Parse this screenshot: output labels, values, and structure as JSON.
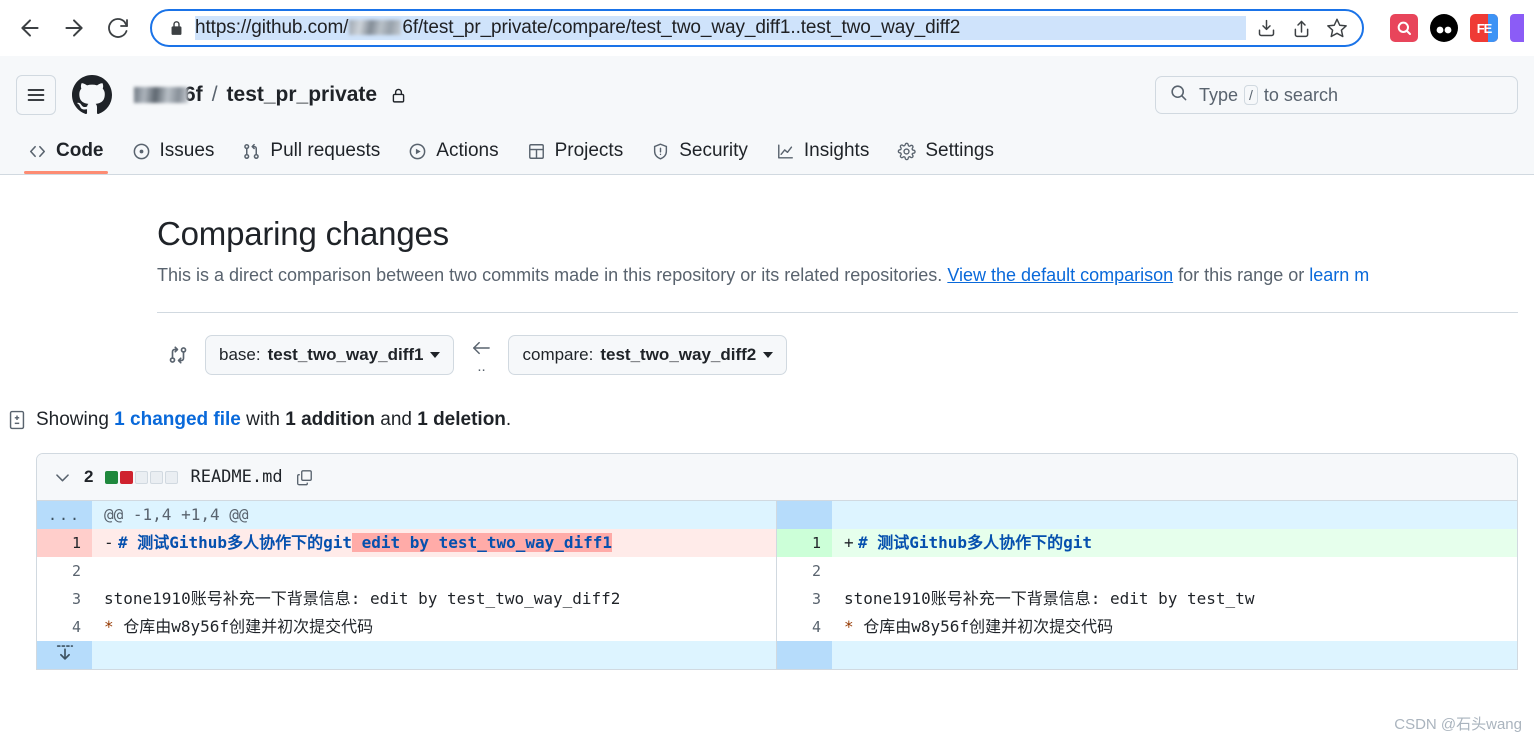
{
  "browser": {
    "back_label": "Back",
    "forward_label": "Forward",
    "reload_label": "Reload",
    "url_prefix": "https://github.com/",
    "url_suffix": "6f/test_pr_private/compare/test_two_way_diff1..test_two_way_diff2",
    "lock_icon": "lock-icon",
    "download_icon": "download-icon",
    "share_icon": "share-icon",
    "bookmark_icon": "star-icon",
    "extensions": [
      {
        "name": "search-extension",
        "label": "Q"
      },
      {
        "name": "eyes-extension",
        "label": ""
      },
      {
        "name": "fe-extension",
        "label": "FE"
      },
      {
        "name": "purple-extension",
        "label": ""
      }
    ]
  },
  "header": {
    "hamburger_icon": "hamburger-icon",
    "logo_icon": "github-logo-icon",
    "owner_suffix": "6f",
    "separator": "/",
    "repo": "test_pr_private",
    "visibility_icon": "lock-icon",
    "search": {
      "placeholder_prefix": "Type",
      "placeholder_key": "/",
      "placeholder_suffix": "to search",
      "icon": "search-icon"
    },
    "tabs": [
      {
        "label": "Code",
        "icon": "code-icon",
        "active": true
      },
      {
        "label": "Issues",
        "icon": "issue-opened-icon",
        "active": false
      },
      {
        "label": "Pull requests",
        "icon": "git-pull-request-icon",
        "active": false
      },
      {
        "label": "Actions",
        "icon": "play-icon",
        "active": false
      },
      {
        "label": "Projects",
        "icon": "table-icon",
        "active": false
      },
      {
        "label": "Security",
        "icon": "shield-icon",
        "active": false
      },
      {
        "label": "Insights",
        "icon": "graph-icon",
        "active": false
      },
      {
        "label": "Settings",
        "icon": "gear-icon",
        "active": false
      }
    ]
  },
  "page": {
    "title": "Comparing changes",
    "subtitle_part1": "This is a direct comparison between two commits made in this repository or its related repositories.",
    "subtitle_link1": "View the default comparison",
    "subtitle_part2": "for this range or",
    "subtitle_link2": "learn m"
  },
  "compare": {
    "branch_icon": "git-compare-icon",
    "base_prefix": "base:",
    "base_branch": "test_two_way_diff1",
    "arrow_icon": "arrow-left-icon",
    "range_dots": "..",
    "compare_prefix": "compare:",
    "compare_branch": "test_two_way_diff2"
  },
  "summary": {
    "icon": "diff-icon",
    "showing": "Showing",
    "files_link": "1 changed file",
    "with": "with",
    "additions": "1 addition",
    "and": "and",
    "deletions": "1 deletion",
    "period": "."
  },
  "file": {
    "collapse_icon": "chevron-down-icon",
    "change_count": "2",
    "stat_blocks": [
      "add",
      "del",
      "neutral",
      "neutral",
      "neutral"
    ],
    "name": "README.md",
    "copy_icon": "copy-icon",
    "hunk_header": "@@ -1,4 +1,4 @@",
    "hunk_gutter": "...",
    "expand_icon": "expand-down-icon",
    "left_rows": [
      {
        "num": "1",
        "type": "del",
        "sign": "-",
        "prefix": "# ",
        "heading": "测试Github多人协作下的git",
        "highlight": "  edit by test_two_way_diff1",
        "plain": ""
      },
      {
        "num": "2",
        "type": "ctx",
        "sign": " ",
        "prefix": "",
        "heading": "",
        "highlight": "",
        "plain": ""
      },
      {
        "num": "3",
        "type": "ctx",
        "sign": " ",
        "prefix": "",
        "heading": "",
        "highlight": "",
        "plain": "stone1910账号补充一下背景信息:  edit by test_two_way_diff2"
      },
      {
        "num": "4",
        "type": "ctx",
        "sign": " ",
        "prefix": "",
        "heading": "",
        "highlight": "",
        "plain": "* 仓库由w8y56f创建并初次提交代码",
        "star": true
      }
    ],
    "right_rows": [
      {
        "num": "1",
        "type": "add",
        "sign": "+",
        "prefix": "# ",
        "heading": "测试Github多人协作下的git",
        "highlight": "",
        "plain": ""
      },
      {
        "num": "2",
        "type": "ctx",
        "sign": " ",
        "prefix": "",
        "heading": "",
        "highlight": "",
        "plain": ""
      },
      {
        "num": "3",
        "type": "ctx",
        "sign": " ",
        "prefix": "",
        "heading": "",
        "highlight": "",
        "plain": "stone1910账号补充一下背景信息:  edit by test_tw"
      },
      {
        "num": "4",
        "type": "ctx",
        "sign": " ",
        "prefix": "",
        "heading": "",
        "highlight": "",
        "plain": "* 仓库由w8y56f创建并初次提交代码",
        "star": true
      }
    ]
  },
  "watermark": "CSDN @石头wang",
  "colors": {
    "accent": "#0969da",
    "active_tab_underline": "#fd8c73",
    "addition": "#1f883d",
    "deletion": "#cf222e",
    "omnibox_focus": "#1a73e8"
  }
}
